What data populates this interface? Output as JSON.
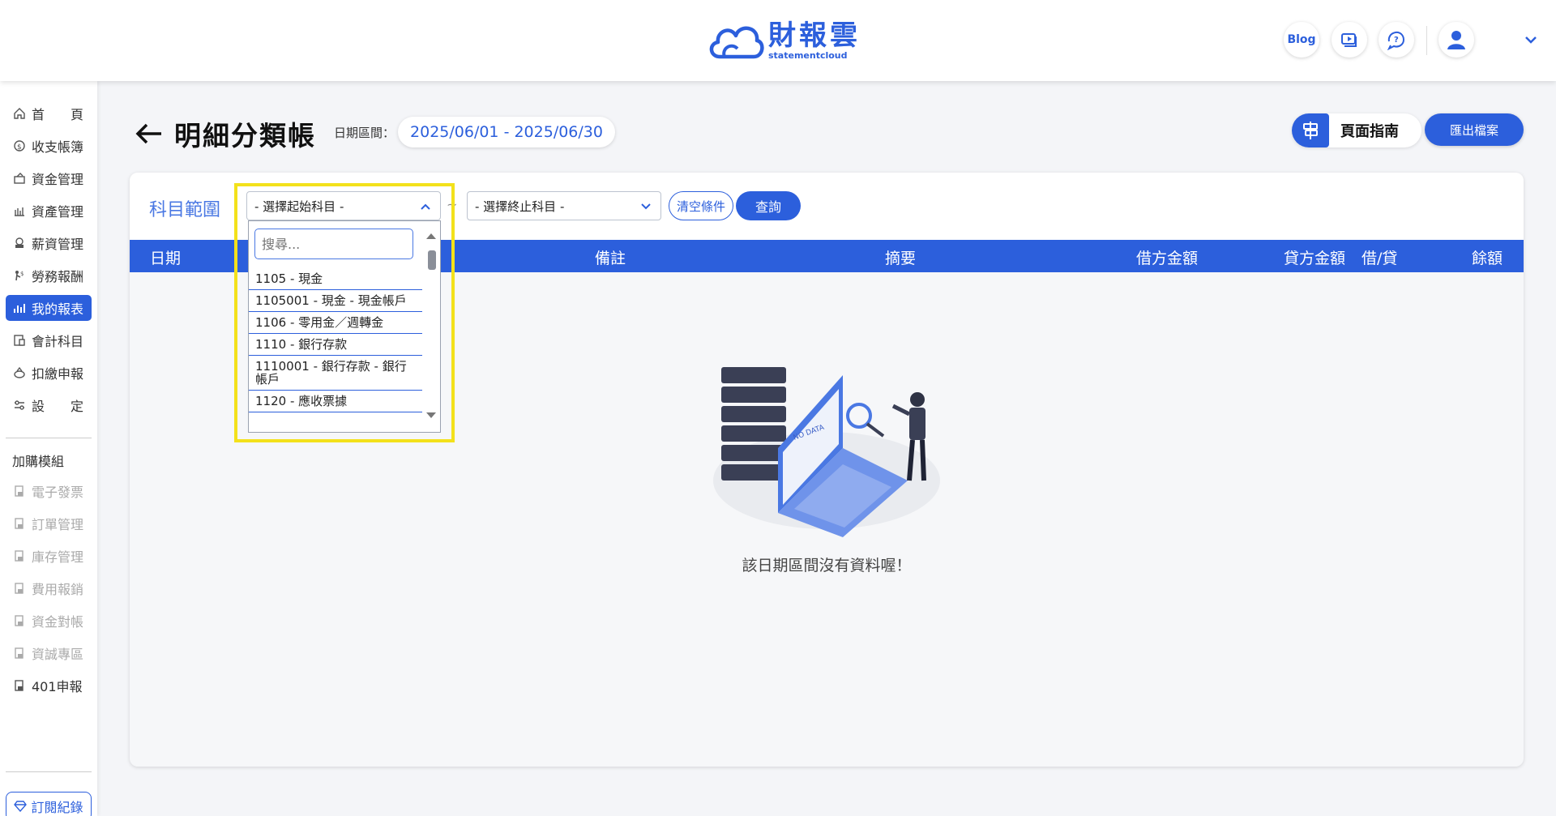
{
  "header": {
    "logo_zh": "財報雲",
    "logo_en": "statementcloud",
    "blog_label": "Blog",
    "icons": [
      "video-icon",
      "help-chat-icon",
      "user-avatar-icon",
      "chevron-down-icon"
    ]
  },
  "sidebar": {
    "items": [
      {
        "label": "首　　頁",
        "icon": "home-icon"
      },
      {
        "label": "收支帳簿",
        "icon": "ledger-icon"
      },
      {
        "label": "資金管理",
        "icon": "fund-icon"
      },
      {
        "label": "資產管理",
        "icon": "asset-icon"
      },
      {
        "label": "薪資管理",
        "icon": "salary-icon"
      },
      {
        "label": "勞務報酬",
        "icon": "labor-icon"
      },
      {
        "label": "我的報表",
        "icon": "report-icon",
        "active": true
      },
      {
        "label": "會計科目",
        "icon": "account-icon"
      },
      {
        "label": "扣繳申報",
        "icon": "withholding-icon"
      },
      {
        "label": "設　　定",
        "icon": "settings-icon"
      }
    ],
    "group_label": "加購模組",
    "addons": [
      {
        "label": "電子發票",
        "disabled": true
      },
      {
        "label": "訂單管理",
        "disabled": true
      },
      {
        "label": "庫存管理",
        "disabled": true
      },
      {
        "label": "費用報銷",
        "disabled": true
      },
      {
        "label": "資金對帳",
        "disabled": true
      },
      {
        "label": "資誠專區",
        "disabled": true
      },
      {
        "label": "401申報",
        "disabled": false
      }
    ],
    "subscription_label": "訂閱紀錄"
  },
  "page": {
    "title": "明細分類帳",
    "date_label": "日期區間：",
    "date_range": "2025/06/01 - 2025/06/30",
    "guide_label": "頁面指南",
    "export_label": "匯出檔案"
  },
  "filter": {
    "range_label": "科目範圍",
    "start_placeholder": "- 選擇起始科目 -",
    "tilde": "~",
    "end_placeholder": "- 選擇終止科目 -",
    "clear_label": "清空條件",
    "query_label": "查詢"
  },
  "table": {
    "columns": [
      "日期",
      "備註",
      "摘要",
      "借方金額",
      "貸方金額",
      "借/貸",
      "餘額"
    ],
    "empty_text": "該日期區間沒有資料喔！",
    "illustration_text": "NO DATA"
  },
  "dropdown": {
    "search_placeholder": "搜尋...",
    "options": [
      "1105 - 現金",
      "1105001 - 現金 - 現金帳戶",
      "1106 - 零用金／週轉金",
      "1110 - 銀行存款",
      "1110001 - 銀行存款 - 銀行帳戶",
      "1120 - 應收票據"
    ]
  },
  "colors": {
    "brand": "#2c5fdc",
    "highlight": "#f3e11b"
  }
}
